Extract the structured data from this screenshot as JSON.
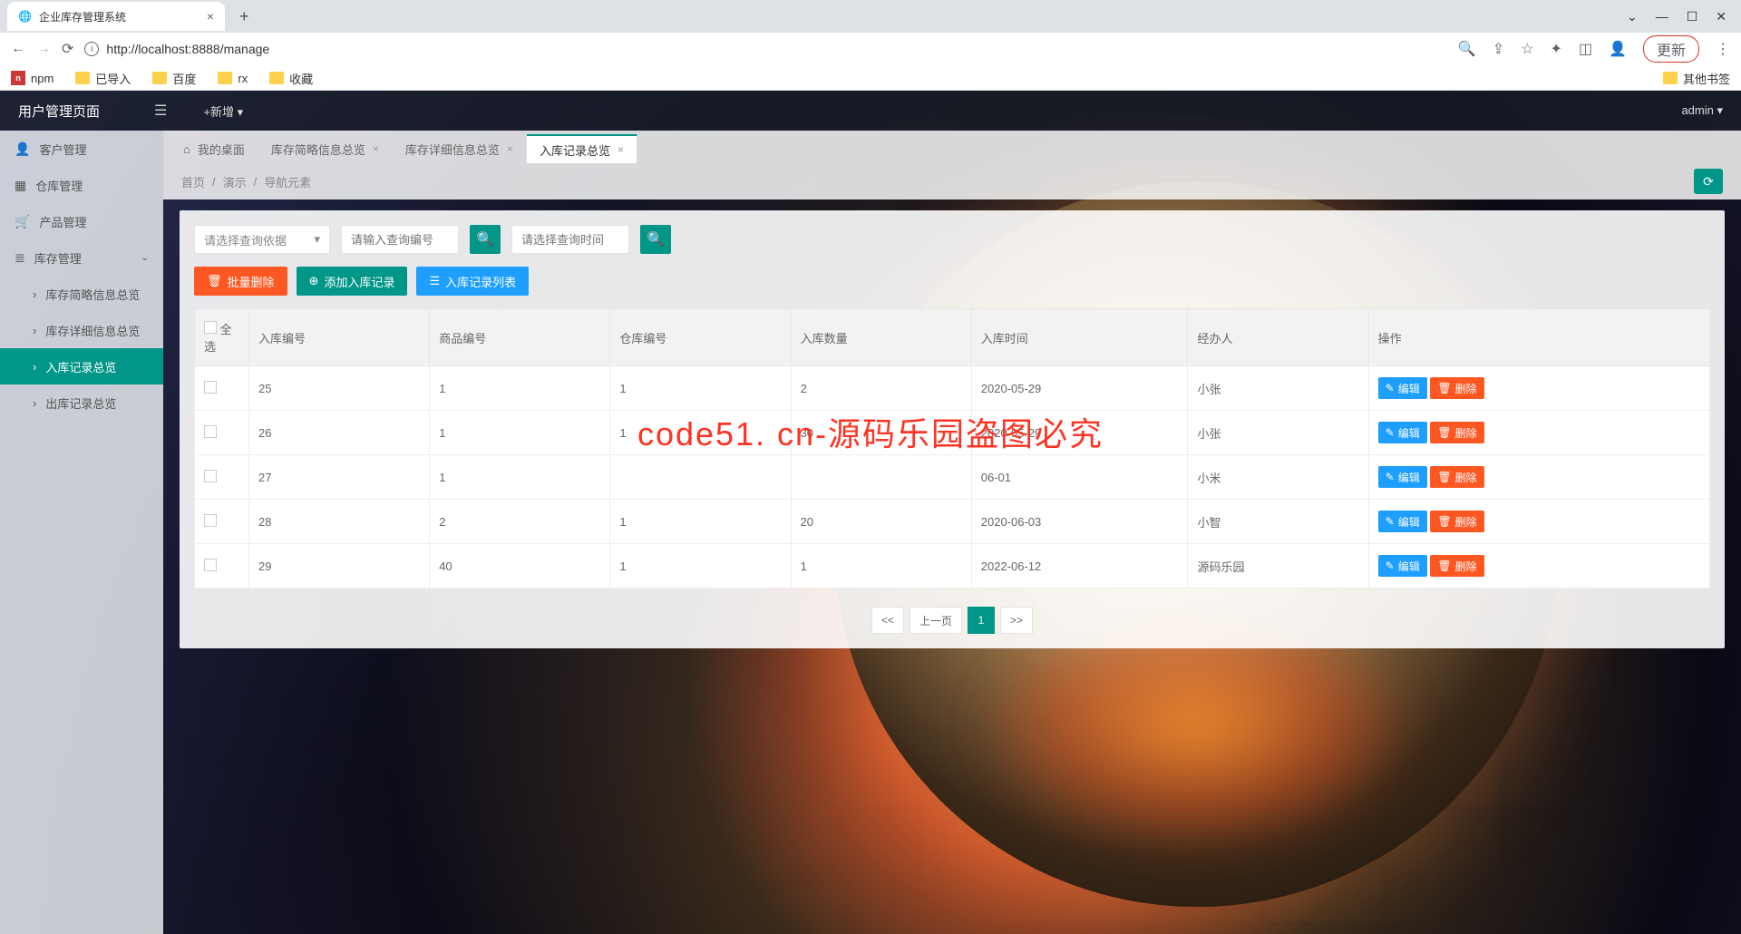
{
  "browser": {
    "tab_title": "企业库存管理系统",
    "url": "http://localhost:8888/manage",
    "update_btn": "更新",
    "bookmarks": [
      "npm",
      "已导入",
      "百度",
      "rx",
      "收藏"
    ],
    "other_bookmarks": "其他书签"
  },
  "topbar": {
    "title": "用户管理页面",
    "add": "+新增 ▾",
    "user": "admin ▾"
  },
  "sidebar": {
    "customer": "客户管理",
    "warehouse": "仓库管理",
    "product": "产品管理",
    "stock": "库存管理",
    "children": {
      "brief": "库存简略信息总览",
      "detail": "库存详细信息总览",
      "in": "入库记录总览",
      "out": "出库记录总览"
    }
  },
  "tabs": {
    "home": "我的桌面",
    "brief": "库存简略信息总览",
    "detail": "库存详细信息总览",
    "in": "入库记录总览"
  },
  "breadcrumb": {
    "a": "首页",
    "b": "演示",
    "c": "导航元素"
  },
  "toolbar": {
    "select_placeholder": "请选择查询依据",
    "search_id_placeholder": "请输入查询编号",
    "search_time_placeholder": "请选择查询时间",
    "batch_delete": "批量删除",
    "add_record": "添加入库记录",
    "list_records": "入库记录列表"
  },
  "table": {
    "headers": {
      "all": "全选",
      "in_id": "入库编号",
      "prod_id": "商品编号",
      "wh_id": "仓库编号",
      "qty": "入库数量",
      "time": "入库时间",
      "operator": "经办人",
      "ops": "操作"
    },
    "edit": "编辑",
    "delete": "删除",
    "rows": [
      {
        "in_id": "25",
        "prod_id": "1",
        "wh_id": "1",
        "qty": "2",
        "time": "2020-05-29",
        "operator": "小张"
      },
      {
        "in_id": "26",
        "prod_id": "1",
        "wh_id": "1",
        "qty": "30",
        "time": "2020-05-29",
        "operator": "小张"
      },
      {
        "in_id": "27",
        "prod_id": "1",
        "wh_id": "",
        "qty": "",
        "time": "06-01",
        "operator": "小米"
      },
      {
        "in_id": "28",
        "prod_id": "2",
        "wh_id": "1",
        "qty": "20",
        "time": "2020-06-03",
        "operator": "小智"
      },
      {
        "in_id": "29",
        "prod_id": "40",
        "wh_id": "1",
        "qty": "1",
        "time": "2022-06-12",
        "operator": "源码乐园"
      }
    ]
  },
  "pager": {
    "first": "<<",
    "prev": "上一页",
    "current": "1",
    "next": ">>"
  },
  "watermark": "code51. cn-源码乐园盗图必究"
}
